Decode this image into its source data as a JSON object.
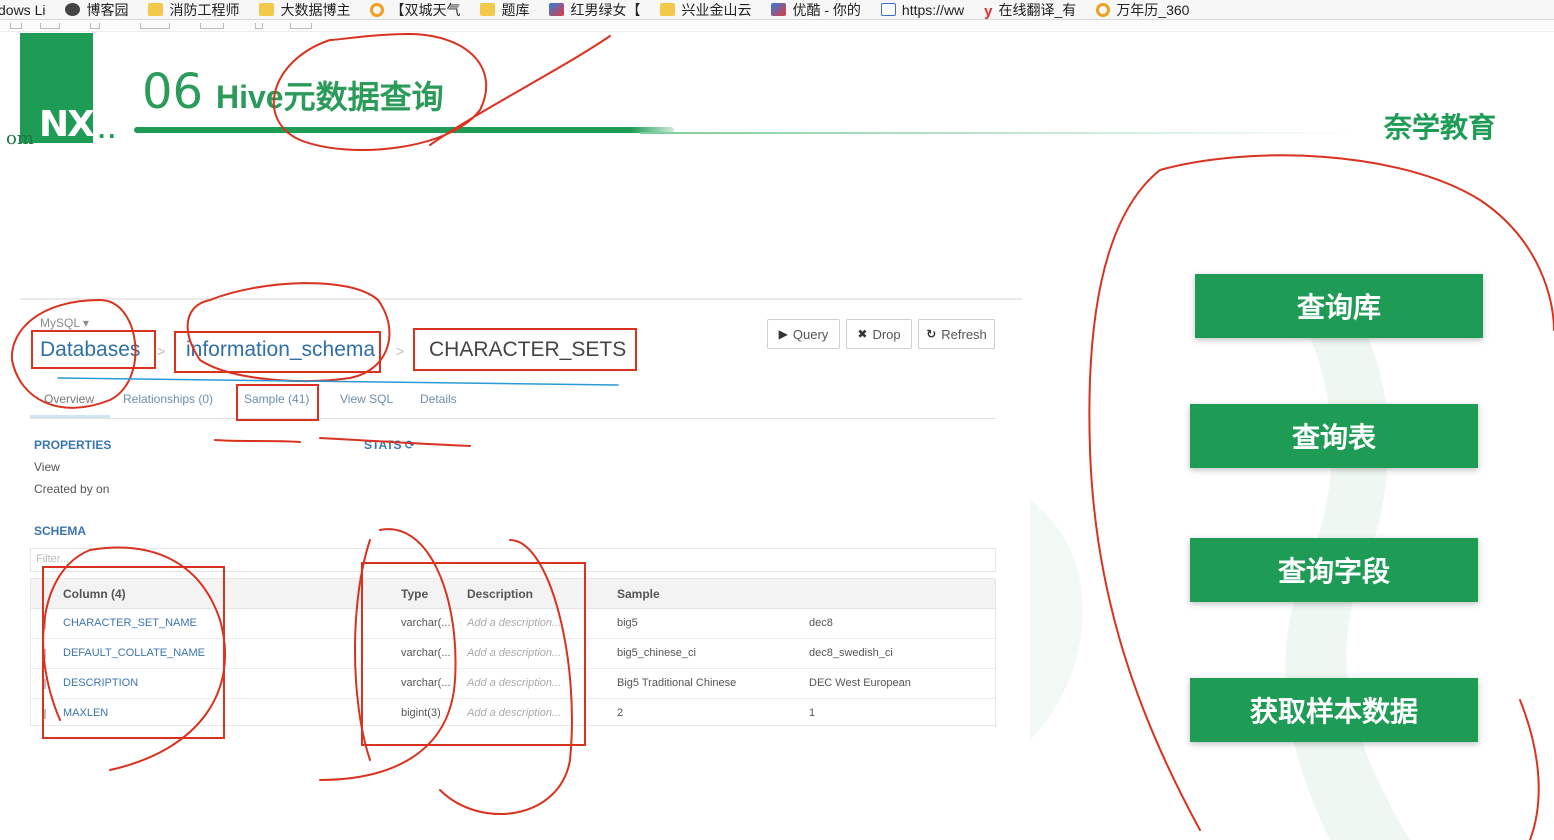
{
  "bookmarks": [
    {
      "label": "dows Li",
      "icon": "windows-icon"
    },
    {
      "label": "博客园",
      "icon": "cat-icon"
    },
    {
      "label": "消防工程师",
      "icon": "folder-icon"
    },
    {
      "label": "大数据博主",
      "icon": "folder-icon"
    },
    {
      "label": "【双城天气",
      "icon": "ring-icon"
    },
    {
      "label": "题库",
      "icon": "folder-icon"
    },
    {
      "label": "红男绿女【",
      "icon": "bird-icon"
    },
    {
      "label": "兴业金山云",
      "icon": "folder-icon"
    },
    {
      "label": "优酷 - 你的",
      "icon": "bird-icon"
    },
    {
      "label": "https://ww",
      "icon": "doc-icon"
    },
    {
      "label": "在线翻译_有",
      "icon": "y-icon"
    },
    {
      "label": "万年历_360",
      "icon": "ring-icon"
    }
  ],
  "slide": {
    "logo": "NX",
    "logo_dots": "..",
    "side_text": "om",
    "section_number": "06",
    "section_title": "Hive元数据查询",
    "brand": "奈学教育"
  },
  "browser": {
    "db_type": "MySQL ▾",
    "breadcrumb": [
      "Databases",
      "information_schema",
      "CHARACTER_SETS"
    ],
    "breadcrumb_sep": ">",
    "actions": [
      {
        "icon": "play-icon",
        "glyph": "▶",
        "label": "Query"
      },
      {
        "icon": "close-icon",
        "glyph": "✖",
        "label": "Drop"
      },
      {
        "icon": "refresh-icon",
        "glyph": "↻",
        "label": "Refresh"
      }
    ],
    "tabs": [
      "Overview",
      "Relationships (0)",
      "Sample (41)",
      "View SQL",
      "Details"
    ],
    "properties_label": "PROPERTIES",
    "stats_label": "STATS ⟳",
    "properties": [
      "View",
      "Created by on"
    ],
    "schema_label": "SCHEMA",
    "filter_placeholder": "Filter...",
    "columns": {
      "headers": [
        "Column (4)",
        "Type",
        "Description",
        "Sample"
      ],
      "rows": [
        {
          "name": "CHARACTER_SET_NAME",
          "type": "varchar(...",
          "desc": "Add a description...",
          "s1": "big5",
          "s2": "dec8"
        },
        {
          "name": "DEFAULT_COLLATE_NAME",
          "type": "varchar(...",
          "desc": "Add a description...",
          "s1": "big5_chinese_ci",
          "s2": "dec8_swedish_ci"
        },
        {
          "name": "DESCRIPTION",
          "type": "varchar(...",
          "desc": "Add a description...",
          "s1": "Big5 Traditional Chinese",
          "s2": "DEC West European"
        },
        {
          "name": "MAXLEN",
          "type": "bigint(3)",
          "desc": "Add a description...",
          "s1": "2",
          "s2": "1"
        }
      ]
    }
  },
  "steps": [
    "查询库",
    "查询表",
    "查询字段",
    "获取样本数据"
  ],
  "colors": {
    "brand_green": "#1e9b55",
    "link_blue": "#3b76b0",
    "annotation_red": "#d9321e"
  }
}
